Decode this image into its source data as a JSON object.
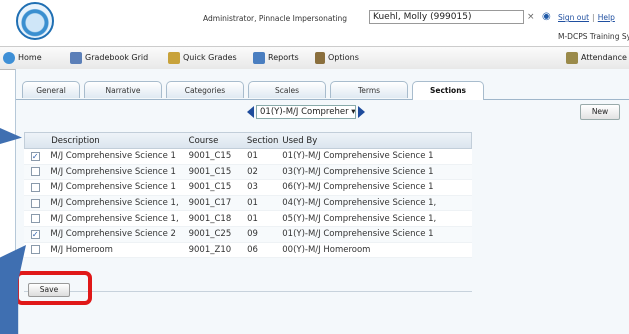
{
  "header": {
    "admin_text": "Administrator, Pinnacle Impersonating",
    "impersonate_value": "Kuehl, Molly (999015)",
    "clear_symbol": "×",
    "sign_out": "Sign out",
    "help": "Help",
    "link_separator": "|",
    "school": "M-DCPS Training System"
  },
  "toolbar": {
    "home": "Home",
    "gradebook_grid": "Gradebook Grid",
    "quick_grades": "Quick Grades",
    "reports": "Reports",
    "options": "Options",
    "attendance": "Attendance"
  },
  "tabs": [
    "General",
    "Narrative",
    "Categories",
    "Scales",
    "Terms",
    "Sections"
  ],
  "active_tab": "Sections",
  "section_selector": {
    "value": "01(Y)-M/J Compreher ▾"
  },
  "new_button": "New",
  "grid": {
    "columns": [
      "Description",
      "Course",
      "Section",
      "Used By"
    ],
    "rows": [
      {
        "checked": "✓",
        "description": "M/J Comprehensive Science 1",
        "course": "9001_C15",
        "section": "01",
        "used_by": "01(Y)-M/J Comprehensive Science 1"
      },
      {
        "checked": "",
        "description": "M/J Comprehensive Science 1",
        "course": "9001_C15",
        "section": "02",
        "used_by": "03(Y)-M/J Comprehensive Science 1"
      },
      {
        "checked": "",
        "description": "M/J Comprehensive Science 1",
        "course": "9001_C15",
        "section": "03",
        "used_by": "06(Y)-M/J Comprehensive Science 1"
      },
      {
        "checked": "",
        "description": "M/J Comprehensive Science 1,",
        "course": "9001_C17",
        "section": "01",
        "used_by": "04(Y)-M/J Comprehensive Science 1,"
      },
      {
        "checked": "",
        "description": "M/J Comprehensive Science 1,",
        "course": "9001_C18",
        "section": "01",
        "used_by": "05(Y)-M/J Comprehensive Science 1,"
      },
      {
        "checked": "✓",
        "description": "M/J Comprehensive Science 2",
        "course": "9001_C25",
        "section": "09",
        "used_by": "01(Y)-M/J Comprehensive Science 1"
      },
      {
        "checked": "",
        "description": "M/J Homeroom",
        "course": "9001_Z10",
        "section": "06",
        "used_by": "00(Y)-M/J Homeroom"
      }
    ]
  },
  "save_button": "Save",
  "colors": {
    "accent_blue": "#1e4c9c",
    "callout_blue": "#3f6fb1",
    "highlight_red": "#e01818"
  }
}
